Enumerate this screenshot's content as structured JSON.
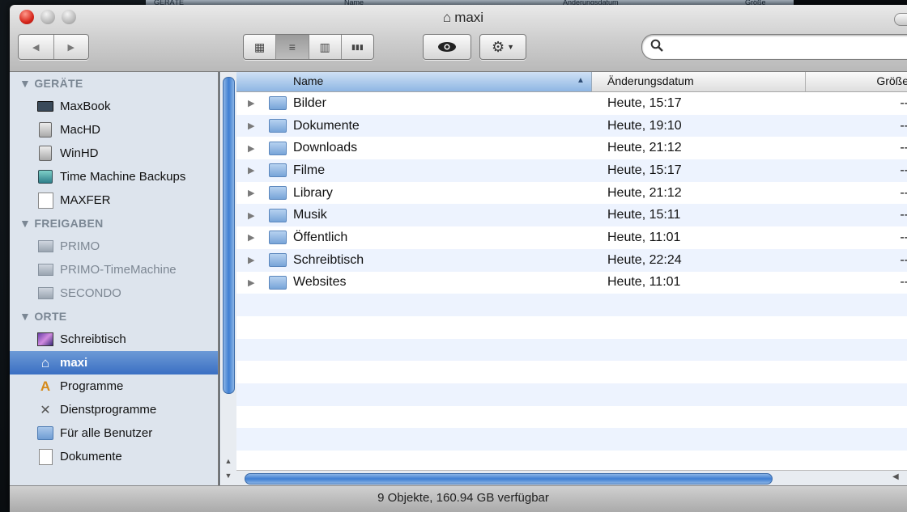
{
  "window": {
    "title": "maxi",
    "title_icon": "home-icon"
  },
  "behind": {
    "labels": [
      "GERÄTE",
      "Name",
      "Änderungsdatum",
      "Größe"
    ]
  },
  "toolbar": {
    "back_icon": "◀",
    "forward_icon": "▶",
    "view_icons": [
      "▦",
      "≡",
      "▥",
      "▮▮▮"
    ],
    "quicklook_icon": "eye-icon",
    "action_icon": "gear-icon",
    "search_placeholder": ""
  },
  "sidebar": {
    "sections": [
      {
        "title": "▼ GERÄTE",
        "items": [
          {
            "label": "MaxBook",
            "icon": "laptop-icon"
          },
          {
            "label": "MacHD",
            "icon": "hard-disk-icon"
          },
          {
            "label": "WinHD",
            "icon": "hard-disk-icon"
          },
          {
            "label": "Time Machine Backups",
            "icon": "time-machine-disk-icon"
          },
          {
            "label": "MAXFER",
            "icon": "external-disk-icon"
          }
        ]
      },
      {
        "title": "▼ FREIGABEN",
        "items": [
          {
            "label": "PRIMO",
            "icon": "network-computer-icon"
          },
          {
            "label": "PRIMO-TimeMachine",
            "icon": "network-computer-icon"
          },
          {
            "label": "SECONDO",
            "icon": "network-computer-icon"
          }
        ]
      },
      {
        "title": "▼ ORTE",
        "items": [
          {
            "label": "Schreibtisch",
            "icon": "desktop-icon"
          },
          {
            "label": "maxi",
            "icon": "home-icon",
            "selected": true
          },
          {
            "label": "Programme",
            "icon": "applications-icon"
          },
          {
            "label": "Dienstprogramme",
            "icon": "utilities-icon"
          },
          {
            "label": "Für alle Benutzer",
            "icon": "folder-icon"
          },
          {
            "label": "Dokumente",
            "icon": "document-icon"
          }
        ]
      }
    ]
  },
  "columns": {
    "name": "Name",
    "sort_indicator": "▲",
    "date": "Änderungsdatum",
    "size": "Größe"
  },
  "files": [
    {
      "name": "Bilder",
      "date": "Heute, 15:17",
      "size": "--"
    },
    {
      "name": "Dokumente",
      "date": "Heute, 19:10",
      "size": "--"
    },
    {
      "name": "Downloads",
      "date": "Heute, 21:12",
      "size": "--"
    },
    {
      "name": "Filme",
      "date": "Heute, 15:17",
      "size": "--"
    },
    {
      "name": "Library",
      "date": "Heute, 21:12",
      "size": "--"
    },
    {
      "name": "Musik",
      "date": "Heute, 15:11",
      "size": "--"
    },
    {
      "name": "Öffentlich",
      "date": "Heute, 11:01",
      "size": "--"
    },
    {
      "name": "Schreibtisch",
      "date": "Heute, 22:24",
      "size": "--"
    },
    {
      "name": "Websites",
      "date": "Heute, 11:01",
      "size": "--"
    }
  ],
  "status": {
    "text": "9 Objekte, 160.94 GB verfügbar"
  }
}
